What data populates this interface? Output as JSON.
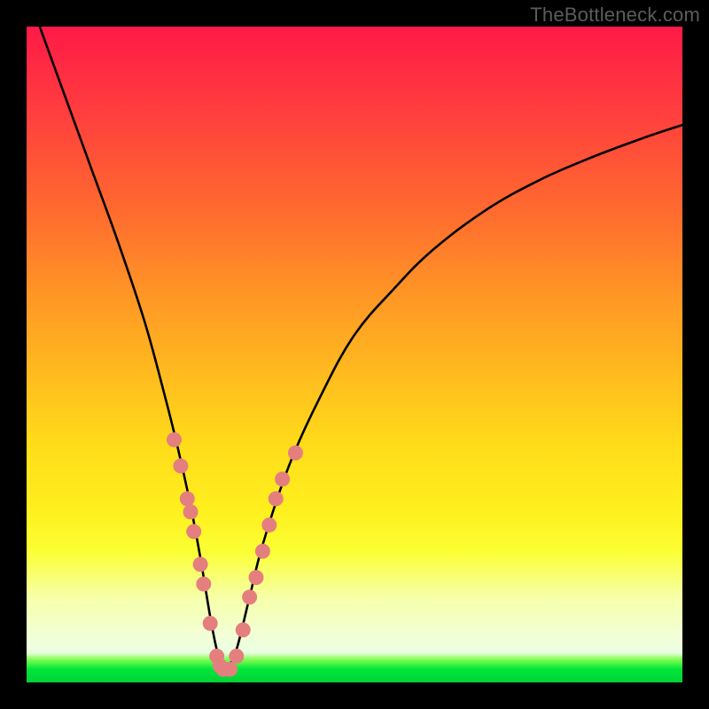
{
  "watermark": "TheBottleneck.com",
  "colors": {
    "curve_stroke": "#000000",
    "marker_fill": "#e57f7f",
    "marker_stroke": "#c96868",
    "frame": "#000000"
  },
  "chart_data": {
    "type": "line",
    "title": "",
    "xlabel": "",
    "ylabel": "",
    "xlim": [
      0,
      100
    ],
    "ylim": [
      0,
      100
    ],
    "grid": false,
    "series": [
      {
        "name": "bottleneck-curve",
        "x": [
          2,
          6,
          10,
          14,
          18,
          21,
          23,
          25,
          26.5,
          28,
          29,
          30,
          30.5,
          32,
          34,
          36,
          40,
          45,
          50,
          56,
          62,
          70,
          78,
          86,
          94,
          100
        ],
        "y": [
          100,
          89,
          78,
          67,
          55,
          44,
          36,
          27,
          19,
          10,
          5,
          2,
          2,
          5,
          13,
          21,
          33,
          44,
          53,
          60,
          66,
          72,
          76.5,
          80,
          83,
          85
        ]
      }
    ],
    "markers": {
      "name": "highlight-dots",
      "points": [
        {
          "x": 22.5,
          "y": 37
        },
        {
          "x": 23.5,
          "y": 33
        },
        {
          "x": 24.5,
          "y": 28
        },
        {
          "x": 25,
          "y": 26
        },
        {
          "x": 25.5,
          "y": 23
        },
        {
          "x": 26.5,
          "y": 18
        },
        {
          "x": 27,
          "y": 15
        },
        {
          "x": 28,
          "y": 9
        },
        {
          "x": 29,
          "y": 4
        },
        {
          "x": 29.5,
          "y": 2.5
        },
        {
          "x": 30,
          "y": 2
        },
        {
          "x": 31,
          "y": 2
        },
        {
          "x": 32,
          "y": 4
        },
        {
          "x": 33,
          "y": 8
        },
        {
          "x": 34,
          "y": 13
        },
        {
          "x": 35,
          "y": 16
        },
        {
          "x": 36,
          "y": 20
        },
        {
          "x": 37,
          "y": 24
        },
        {
          "x": 38,
          "y": 28
        },
        {
          "x": 39,
          "y": 31
        },
        {
          "x": 41,
          "y": 35
        }
      ]
    }
  }
}
